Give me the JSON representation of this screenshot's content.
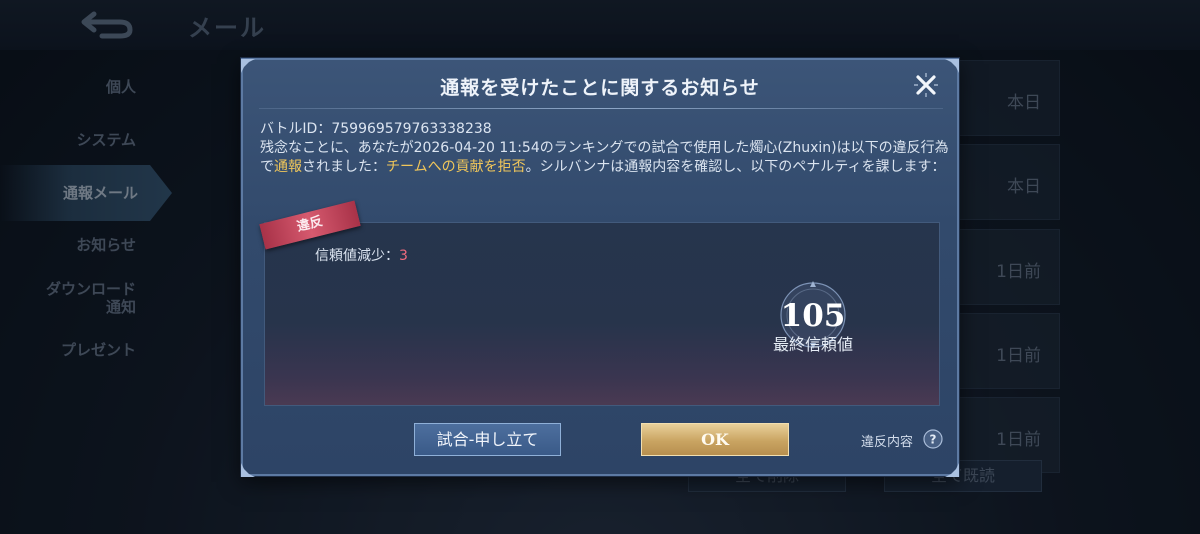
{
  "screen": {
    "title": "メール"
  },
  "sidebar": {
    "items": [
      {
        "label": "個人"
      },
      {
        "label": "システム"
      },
      {
        "label": "通報メール"
      },
      {
        "label": "お知らせ"
      },
      {
        "label": "ダウンロード\n通知"
      },
      {
        "label": "プレゼント"
      }
    ]
  },
  "mail_list": {
    "dates": [
      "本日",
      "本日",
      "1日前",
      "1日前",
      "1日前"
    ]
  },
  "bottom_buttons": {
    "delete_all": "全て削除",
    "read_all": "全て既読"
  },
  "modal": {
    "title": "通報を受けたことに関するお知らせ",
    "battle_id_label": "バトルID：",
    "battle_id": "759969579763338238",
    "msg_part1": "残念なことに、あなたが2026-04-20 11:54のランキングでの試合で使用した燭心(Zhuxin)は以下の違反行為で",
    "msg_hl1": "通報",
    "msg_part2": "されました：",
    "msg_hl2": "チームへの貢献を拒否",
    "msg_part3": "。シルバンナは通報内容を確認し、以下のペナルティを課します：",
    "ribbon": "違反",
    "penalty_label": "信頼値減少：",
    "penalty_value": "3",
    "final_score": "105",
    "final_score_label": "最終信頼値",
    "appeal_button": "試合-申し立て",
    "ok_button": "OK",
    "violation_details": "違反内容"
  },
  "colors": {
    "accent_gold": "#f0c65a",
    "penalty_red": "#ee6b7d",
    "ok_gold": "#c9a462",
    "modal_blue": "#344d70"
  }
}
